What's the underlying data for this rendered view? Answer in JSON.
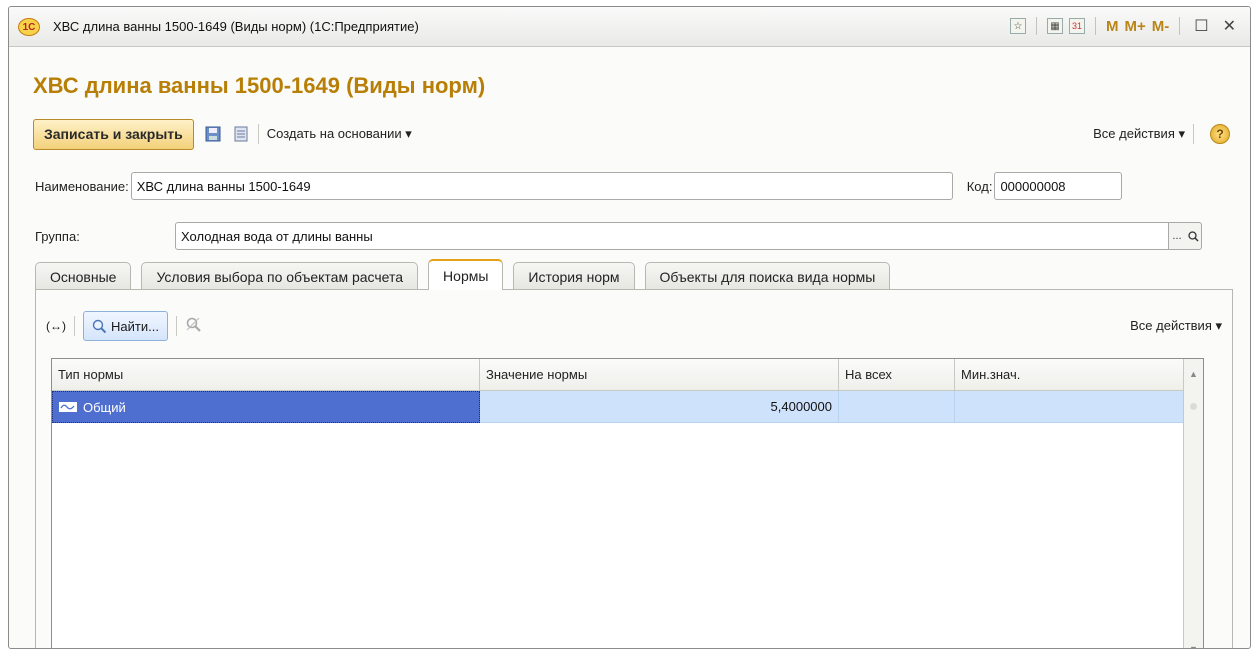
{
  "window": {
    "title": "ХВС длина ванны 1500-1649 (Виды норм)  (1С:Предприятие)",
    "logo_text": "1С",
    "m_label": "M",
    "mplus_label": "M+",
    "mminus_label": "M-",
    "maximize_glyph": "☐",
    "close_glyph": "✕",
    "calendar_day": "31"
  },
  "form": {
    "heading": "ХВС длина ванны 1500-1649 (Виды норм)",
    "toolbar": {
      "save_close": "Записать и закрыть",
      "create_based": "Создать на основании ▾",
      "all_actions": "Все действия ▾",
      "help": "?"
    },
    "name_label": "Наименование:",
    "name_value": "ХВС длина ванны 1500-1649",
    "code_label": "Код:",
    "code_value": "000000008",
    "group_label": "Группа:",
    "group_value": "Холодная вода от длины ванны",
    "group_select": "...",
    "tabs": [
      "Основные",
      "Условия выбора по объектам расчета",
      "Нормы",
      "История норм",
      "Объекты для поиска вида нормы"
    ],
    "active_tab": 2
  },
  "norms": {
    "toolbar": {
      "expand": "(↔)",
      "find": "Найти...",
      "all_actions": "Все действия ▾"
    },
    "columns": [
      "Тип нормы",
      "Значение нормы",
      "На всех",
      "Мин.знач."
    ],
    "rows": [
      {
        "type": "Общий",
        "value": "5,4000000",
        "all": "",
        "min": ""
      }
    ]
  },
  "colors": {
    "heading": "#b87f06",
    "selected_row": "#4e6fcf",
    "row_highlight": "#cfe2fb"
  }
}
